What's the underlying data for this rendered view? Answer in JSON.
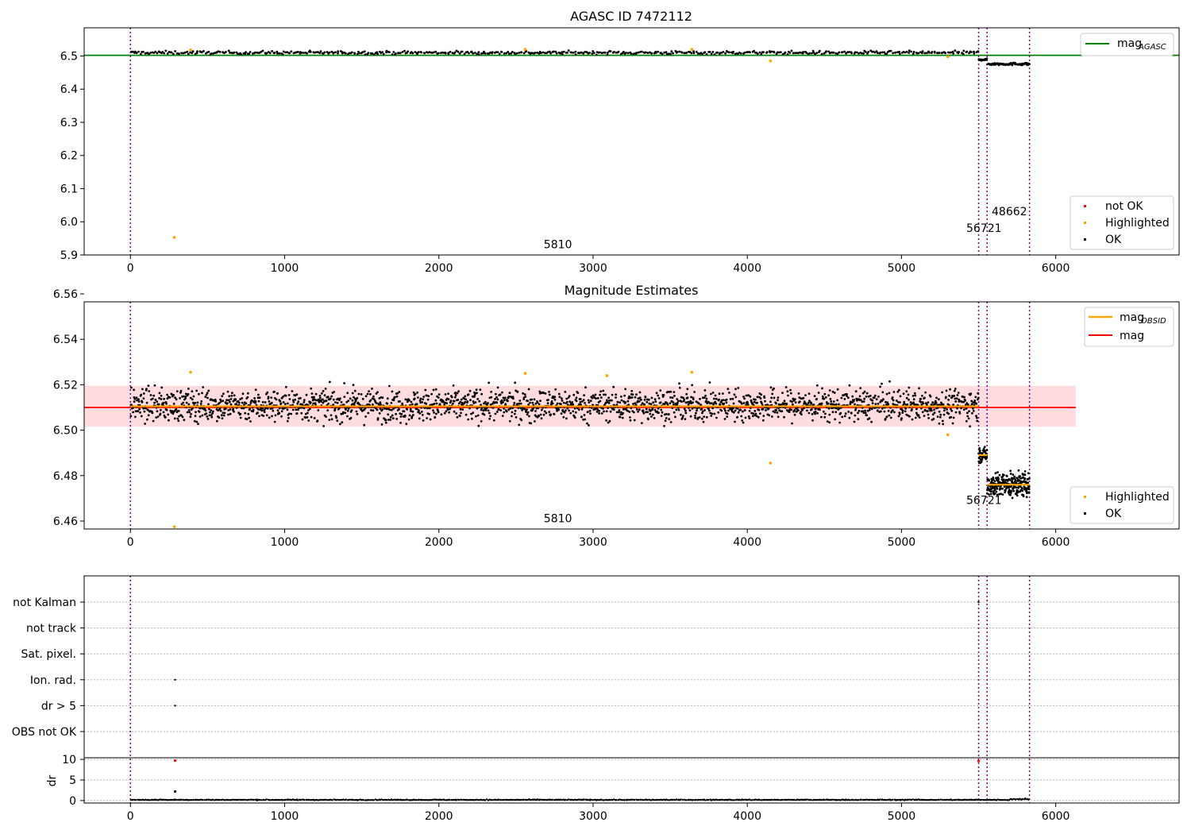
{
  "chart_data": [
    {
      "type": "scatter",
      "title": "AGASC ID 7472112",
      "xlim": [
        -300,
        6800
      ],
      "ylim": [
        5.9,
        6.585
      ],
      "xticks": [
        0,
        1000,
        2000,
        3000,
        4000,
        5000,
        6000
      ],
      "yticks": [
        5.9,
        6.0,
        6.1,
        6.2,
        6.3,
        6.4,
        6.5
      ],
      "vlines": [
        0,
        5500,
        5555,
        5830
      ],
      "annotations": [
        {
          "text": "5810",
          "x": 2680,
          "y": 5.92
        },
        {
          "text": "56721",
          "x": 5420,
          "y": 5.97
        },
        {
          "text": "48662",
          "x": 5585,
          "y": 6.02
        }
      ],
      "reference_lines": [
        {
          "name": "magAGASC",
          "y": 6.502,
          "color": "#008000"
        }
      ],
      "series": [
        {
          "name": "OK",
          "color": "#000000",
          "segments": [
            {
              "x0": 0,
              "x1": 5500,
              "center": 6.51,
              "spread": 0.008,
              "n": 560
            },
            {
              "x0": 5500,
              "x1": 5555,
              "center": 6.489,
              "spread": 0.004,
              "n": 20
            },
            {
              "x0": 5555,
              "x1": 5830,
              "center": 6.476,
              "spread": 0.006,
              "n": 70
            }
          ]
        },
        {
          "name": "Highlighted",
          "color": "#ffa500",
          "points": [
            [
              285,
              5.953
            ],
            [
              4150,
              6.485
            ],
            [
              5300,
              6.498
            ],
            [
              2560,
              6.52
            ],
            [
              3640,
              6.52
            ],
            [
              390,
              6.518
            ]
          ]
        },
        {
          "name": "not OK",
          "color": "#ff0000",
          "points": []
        }
      ],
      "legend_upper": [
        "magAGASC"
      ],
      "legend_lower": [
        "not OK",
        "Highlighted",
        "OK"
      ]
    },
    {
      "type": "scatter",
      "title": "Magnitude Estimates",
      "xlim": [
        -300,
        6800
      ],
      "ylim": [
        6.4565,
        6.5565
      ],
      "xticks": [
        0,
        1000,
        2000,
        3000,
        4000,
        5000,
        6000
      ],
      "yticks": [
        6.46,
        6.48,
        6.5,
        6.52,
        6.54,
        6.56
      ],
      "vlines": [
        0,
        5500,
        5555,
        5830
      ],
      "annotations": [
        {
          "text": "5810",
          "x": 2680,
          "y": 6.4595
        },
        {
          "text": "56721",
          "x": 5420,
          "y": 6.4675
        }
      ],
      "mag": {
        "value": 6.51,
        "band": [
          6.5015,
          6.5195
        ],
        "x_range": [
          -300,
          6130
        ]
      },
      "obsid_mags": [
        {
          "x0": 0,
          "x1": 5500,
          "value": 6.5105
        },
        {
          "x0": 5500,
          "x1": 5555,
          "value": 6.489
        },
        {
          "x0": 5555,
          "x1": 5830,
          "value": 6.476
        }
      ],
      "series": [
        {
          "name": "OK",
          "color": "#000000",
          "segments": [
            {
              "x0": 0,
              "x1": 5500,
              "center": 6.511,
              "spread": 0.011,
              "n": 2200
            },
            {
              "x0": 5500,
              "x1": 5555,
              "center": 6.489,
              "spread": 0.005,
              "n": 40
            },
            {
              "x0": 5555,
              "x1": 5830,
              "center": 6.476,
              "spread": 0.008,
              "n": 260
            }
          ]
        },
        {
          "name": "Highlighted",
          "color": "#ffa500",
          "points": [
            [
              285,
              6.4575
            ],
            [
              390,
              6.5255
            ],
            [
              2560,
              6.525
            ],
            [
              3090,
              6.524
            ],
            [
              3640,
              6.5255
            ],
            [
              4150,
              6.4855
            ],
            [
              5300,
              6.498
            ]
          ]
        }
      ],
      "legend_upper": [
        "magOBSID",
        "mag"
      ],
      "legend_lower": [
        "Highlighted",
        "OK"
      ]
    },
    {
      "type": "scatter",
      "title": "",
      "xlim": [
        -300,
        6800
      ],
      "xticks": [
        0,
        1000,
        2000,
        3000,
        4000,
        5000,
        6000
      ],
      "vlines": [
        0,
        5500,
        5555,
        5830
      ],
      "categories": [
        "not Kalman",
        "not track",
        "Sat. pixel.",
        "Ion. rad.",
        "dr > 5",
        "OBS not OK"
      ],
      "flag_points": [
        {
          "category": "Ion. rad.",
          "x": 290
        },
        {
          "category": "dr > 5",
          "x": 290
        },
        {
          "category": "not Kalman",
          "x": 5500
        }
      ],
      "dr": {
        "ylabel": "dr",
        "ylim": [
          -0.6,
          10.4
        ],
        "yticks": [
          0,
          5,
          10
        ],
        "gridlines": [
          0,
          5,
          10
        ],
        "outliers": [
          [
            290,
            2.2,
            "#000000"
          ],
          [
            290,
            9.7,
            "#ff0000"
          ],
          [
            5500,
            9.6,
            "#ff0000"
          ]
        ],
        "baseline": [
          {
            "x0": 0,
            "x1": 5700,
            "center": 0.18,
            "spread": 0.15
          },
          {
            "x0": 5700,
            "x1": 5830,
            "center": 0.35,
            "spread": 0.3
          }
        ]
      }
    }
  ],
  "legend": {
    "mag_agasc_main": "mag",
    "mag_agasc_sub": "AGASC",
    "mag_obsid_main": "mag",
    "mag_obsid_sub": "OBSID",
    "mag": "mag",
    "not_ok": "not OK",
    "highlighted": "Highlighted",
    "ok": "OK"
  },
  "colors": {
    "ok": "#000000",
    "highlighted": "#ffa500",
    "not_ok": "#ff0000",
    "mag_agasc": "#008000",
    "mag": "#ff0000",
    "mag_obsid": "#ffa500",
    "mag_band": "#ffd6da",
    "obs_lines": "#800080"
  }
}
